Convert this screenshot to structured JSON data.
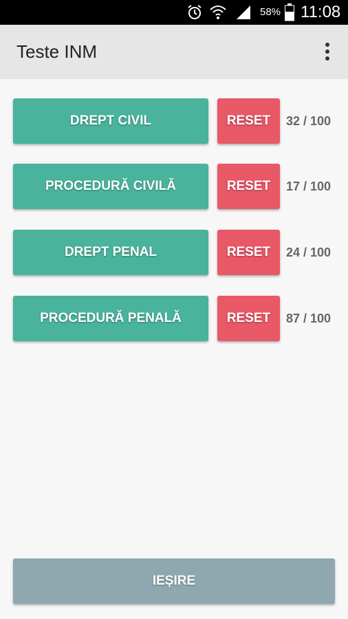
{
  "status_bar": {
    "icons": [
      "alarm-icon",
      "wifi-icon",
      "signal-icon",
      "battery-icon"
    ],
    "battery_percent": "58%",
    "time": "11:08"
  },
  "app_bar": {
    "title": "Teste INM",
    "overflow_icon": "more-vert-icon"
  },
  "subjects": [
    {
      "label": "DREPT CIVIL",
      "reset_label": "RESET",
      "score": "32 / 100"
    },
    {
      "label": "PROCEDURĂ CIVILĂ",
      "reset_label": "RESET",
      "score": "17 / 100"
    },
    {
      "label": "DREPT PENAL",
      "reset_label": "RESET",
      "score": "24 / 100"
    },
    {
      "label": "PROCEDURĂ PENALĂ",
      "reset_label": "RESET",
      "score": "87 / 100"
    }
  ],
  "exit_button": {
    "label": "IEȘIRE"
  },
  "colors": {
    "subject_button": "#49b39c",
    "reset_button": "#e85866",
    "exit_button": "#8fa8b0",
    "app_bar": "#e6e6e6",
    "status_bar": "#000000"
  }
}
